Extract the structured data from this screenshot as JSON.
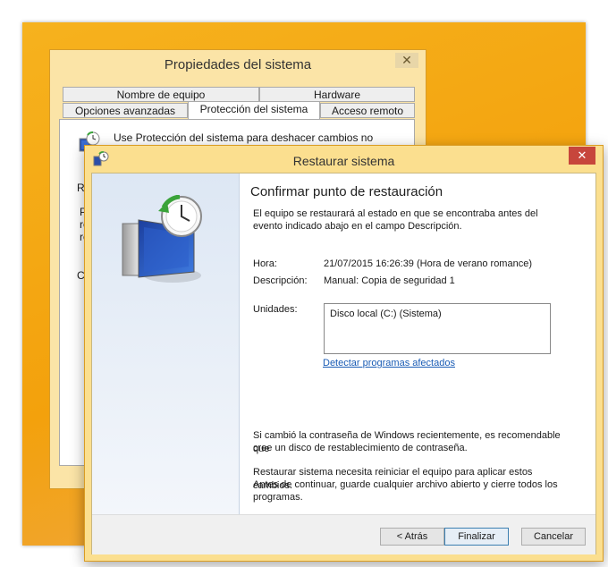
{
  "back_window": {
    "title": "Propiedades del sistema",
    "close_glyph": "✕",
    "tabs_row1": [
      "Nombre de equipo",
      "Hardware"
    ],
    "tabs_row2": [
      "Opciones avanzadas",
      "Protección del sistema",
      "Acceso remoto"
    ],
    "selected_tab": "Protección del sistema",
    "body_intro": "Use Protección del sistema para deshacer cambios no deseados",
    "partial_labels": [
      "Re",
      "P",
      "re",
      "re",
      "Co"
    ]
  },
  "dialog": {
    "title": "Restaurar sistema",
    "close_glyph": "✕",
    "heading": "Confirmar punto de restauración",
    "intro_line1": "El equipo se restaurará al estado en que se encontraba antes del",
    "intro_line2": "evento indicado abajo en el campo Descripción.",
    "hora_label": "Hora:",
    "hora_value": "21/07/2015 16:26:39 (Hora de verano romance)",
    "desc_label": "Descripción:",
    "desc_value": "Manual: Copia de seguridad 1",
    "unidades_label": "Unidades:",
    "unidades_value": "Disco local (C:) (Sistema)",
    "link": "Detectar programas afectados",
    "password_line1": "Si cambió la contraseña de Windows recientemente, es recomendable que",
    "password_line2": "cree un disco de restablecimiento de contraseña.",
    "restart_line1": "Restaurar sistema necesita reiniciar el equipo para aplicar estos cambios.",
    "restart_line2": "Antes de continuar, guarde cualquier archivo abierto y cierre todos los",
    "restart_line3": "programas.",
    "buttons": {
      "back": "< Atrás",
      "finish": "Finalizar",
      "cancel": "Cancelar"
    }
  },
  "colors": {
    "desktop": "#f3a10c",
    "window_frame": "#fbdf8f",
    "close_button": "#c7463c",
    "link": "#1a5cb5"
  },
  "icons": [
    "system-protection-icon",
    "system-restore-small-icon",
    "system-restore-large-icon"
  ]
}
